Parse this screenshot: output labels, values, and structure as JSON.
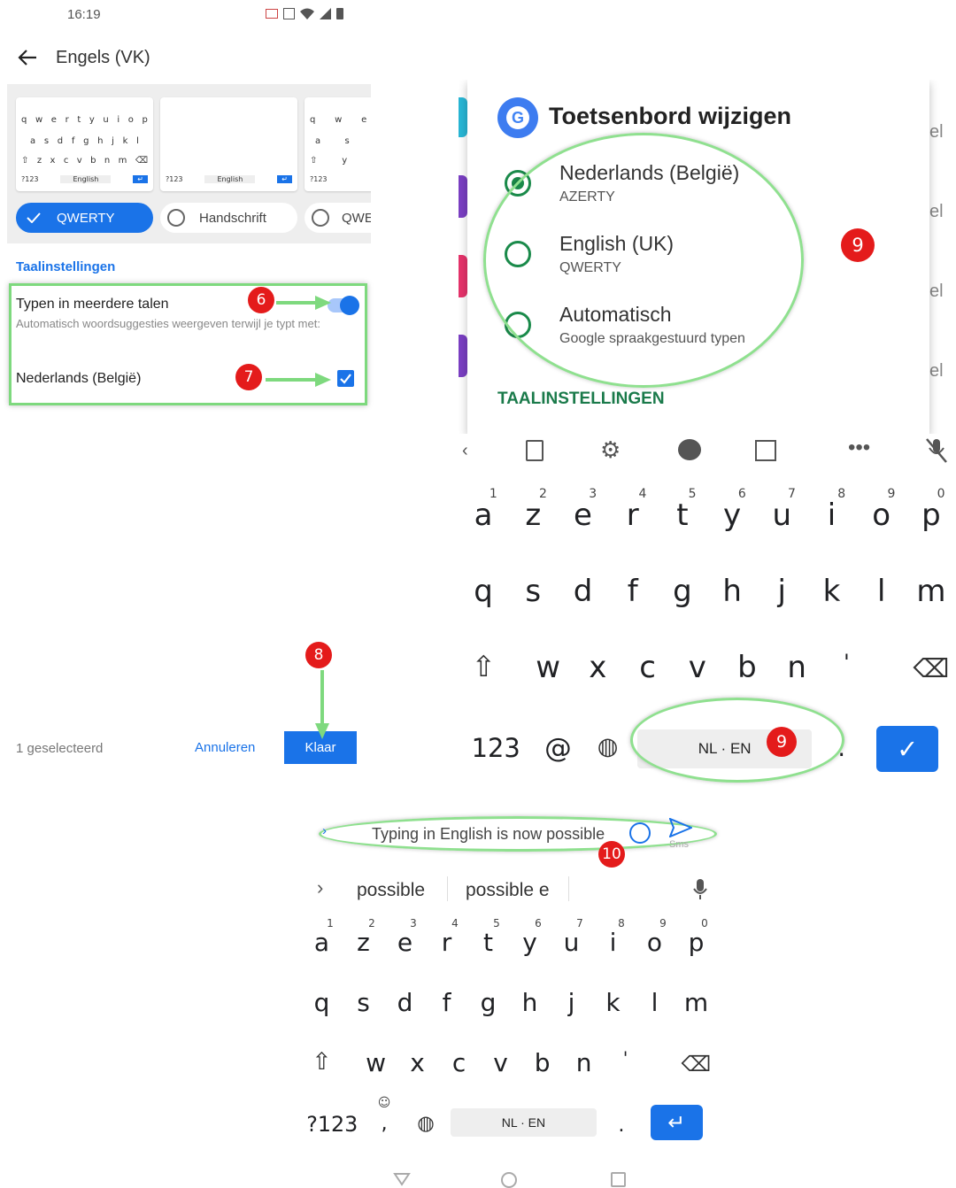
{
  "status_bar": {
    "time": "16:19"
  },
  "settings_screen": {
    "title": "Engels (VK)",
    "layout_options": [
      {
        "label": "QWERTY",
        "selected": true
      },
      {
        "label": "Handschrift",
        "selected": false
      },
      {
        "label": "QWE",
        "selected": false
      }
    ],
    "preview_labels": {
      "num": "?123",
      "space": "English"
    },
    "section_title": "Taalinstellingen",
    "multi_lang": {
      "title": "Typen in meerdere talen",
      "description": "Automatisch woordsuggesties weergeven terwijl je typt met:",
      "toggle_on": true
    },
    "language_item": {
      "label": "Nederlands (België)",
      "checked": true
    },
    "footer": {
      "selected_count": "1 geselecteerd",
      "cancel": "Annuleren",
      "confirm": "Klaar"
    }
  },
  "badges": {
    "b6": "6",
    "b7": "7",
    "b8": "8",
    "b9a": "9",
    "b9b": "9",
    "b10": "10"
  },
  "change_keyboard_dialog": {
    "title": "Toetsenbord wijzigen",
    "options": [
      {
        "name": "Nederlands (België)",
        "sub": "AZERTY",
        "selected": true
      },
      {
        "name": "English (UK)",
        "sub": "QWERTY",
        "selected": false
      },
      {
        "name": "Automatisch",
        "sub": "Google spraakgestuurd typen",
        "selected": false
      }
    ],
    "settings_link": "TAALINSTELLINGEN",
    "bg_fragments": [
      "el",
      "el",
      "el",
      "el"
    ]
  },
  "keyboard_top": {
    "row1": [
      [
        "a",
        "1"
      ],
      [
        "z",
        "2"
      ],
      [
        "e",
        "3"
      ],
      [
        "r",
        "4"
      ],
      [
        "t",
        "5"
      ],
      [
        "y",
        "6"
      ],
      [
        "u",
        "7"
      ],
      [
        "i",
        "8"
      ],
      [
        "o",
        "9"
      ],
      [
        "p",
        "0"
      ]
    ],
    "row2": [
      "q",
      "s",
      "d",
      "f",
      "g",
      "h",
      "j",
      "k",
      "l",
      "m"
    ],
    "row3": [
      "w",
      "x",
      "c",
      "v",
      "b",
      "n",
      "'"
    ],
    "num_key": "123",
    "at_key": "@",
    "space_label": "NL · EN",
    "period": "."
  },
  "message_bar": {
    "text": "Typing in English is now possible",
    "send_label": "Sms"
  },
  "suggestions": [
    "possible",
    "possible e"
  ],
  "keyboard_bottom": {
    "row1": [
      [
        "a",
        "1"
      ],
      [
        "z",
        "2"
      ],
      [
        "e",
        "3"
      ],
      [
        "r",
        "4"
      ],
      [
        "t",
        "5"
      ],
      [
        "y",
        "6"
      ],
      [
        "u",
        "7"
      ],
      [
        "i",
        "8"
      ],
      [
        "o",
        "9"
      ],
      [
        "p",
        "0"
      ]
    ],
    "row2": [
      "q",
      "s",
      "d",
      "f",
      "g",
      "h",
      "j",
      "k",
      "l",
      "m"
    ],
    "row3": [
      "w",
      "x",
      "c",
      "v",
      "b",
      "n",
      "'"
    ],
    "num_key": "?123",
    "comma": ",",
    "space_label": "NL · EN",
    "period": "."
  },
  "colors": {
    "accent": "#1a73e8",
    "highlight": "#8fe08f",
    "badge": "#e41b1b"
  }
}
